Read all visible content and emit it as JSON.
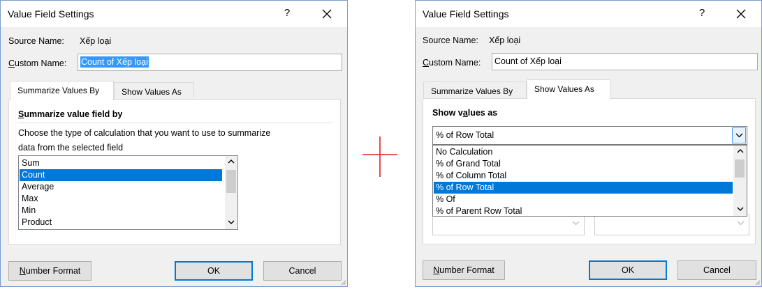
{
  "left": {
    "title": "Value Field Settings",
    "help": "?",
    "source_name_label": "Source Name:",
    "source_name_value": "Xếp loại",
    "custom_name_label_u": "C",
    "custom_name_label_rest": "ustom Name:",
    "custom_name_value": "Count of Xếp loại",
    "tabs": [
      {
        "label": "Summarize Values By",
        "active": true
      },
      {
        "label": "Show Values As",
        "active": false
      }
    ],
    "section_title_u": "S",
    "section_title_rest": "ummarize value field by",
    "description_line1": "Choose the type of calculation that you want to use to summarize",
    "description_line2": "data from the selected field",
    "list": [
      "Sum",
      "Count",
      "Average",
      "Max",
      "Min",
      "Product"
    ],
    "selected_index": 1,
    "number_format_u": "N",
    "number_format_rest": "umber Format",
    "ok": "OK",
    "cancel": "Cancel"
  },
  "right": {
    "title": "Value Field Settings",
    "help": "?",
    "source_name_label": "Source Name:",
    "source_name_value": "Xếp loại",
    "custom_name_label_u": "C",
    "custom_name_label_rest": "ustom Name:",
    "custom_name_value": "Count of Xếp loại",
    "tabs": [
      {
        "label": "Summarize Values By",
        "active": false
      },
      {
        "label": "Show Values As",
        "active": true
      }
    ],
    "section_title_pre": "Show v",
    "section_title_u": "a",
    "section_title_rest": "lues as",
    "combo_value": "% of Row Total",
    "dropdown": [
      "No Calculation",
      "% of Grand Total",
      "% of Column Total",
      "% of Row Total",
      "% Of",
      "% of Parent Row Total"
    ],
    "selected_index": 3,
    "base_field_value": "",
    "base_item_value": "",
    "number_format_u": "N",
    "number_format_rest": "umber Format",
    "ok": "OK",
    "cancel": "Cancel"
  },
  "colors": {
    "selection": "#0078d7",
    "text_selection": "#3399ff",
    "plus_sign": "#e02020",
    "dialog_bg": "#f0f0f0",
    "dialog_border": "#7a9ccf"
  },
  "icons": {
    "close": "close-icon",
    "scroll_up": "chevron-up-icon",
    "scroll_down": "chevron-down-icon",
    "dropdown": "chevron-down-icon",
    "plus": "plus-icon"
  }
}
